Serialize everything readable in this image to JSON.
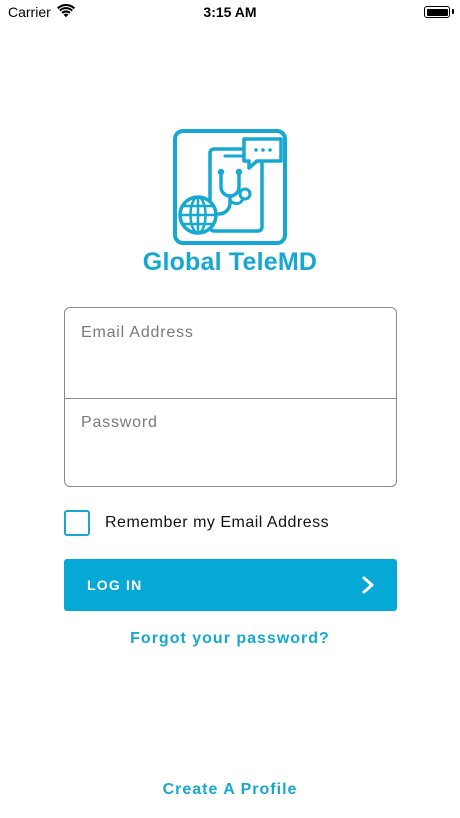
{
  "status_bar": {
    "carrier": "Carrier",
    "time": "3:15 AM"
  },
  "brand": {
    "name": "Global TeleMD",
    "color": "#16a8d0"
  },
  "login_form": {
    "email_placeholder": "Email Address",
    "password_placeholder": "Password"
  },
  "remember": {
    "label": "Remember my Email Address",
    "checked": false
  },
  "login_button": {
    "label": "LOG IN",
    "background": "#06a9d6"
  },
  "links": {
    "forgot_password": "Forgot your password?",
    "create_profile": "Create A Profile"
  },
  "icons": {
    "logo": "telemedicine-logo-icon",
    "wifi": "wifi-icon",
    "battery": "battery-icon",
    "chevron": "chevron-right-icon"
  }
}
